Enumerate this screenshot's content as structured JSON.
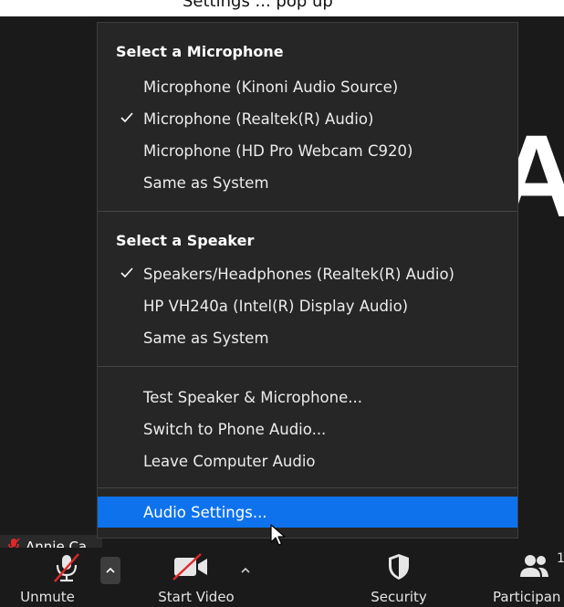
{
  "top_partial_text": "Settings ... pop up",
  "meeting": {
    "big_letter": "A",
    "participant_name": "Annie Ca"
  },
  "audio_menu": {
    "microphone_header": "Select a Microphone",
    "microphones": [
      {
        "label": "Microphone (Kinoni Audio Source)",
        "selected": false
      },
      {
        "label": "Microphone (Realtek(R) Audio)",
        "selected": true
      },
      {
        "label": "Microphone (HD Pro Webcam C920)",
        "selected": false
      },
      {
        "label": "Same as System",
        "selected": false
      }
    ],
    "speaker_header": "Select a Speaker",
    "speakers": [
      {
        "label": "Speakers/Headphones (Realtek(R) Audio)",
        "selected": true
      },
      {
        "label": "HP VH240a (Intel(R) Display Audio)",
        "selected": false
      },
      {
        "label": "Same as System",
        "selected": false
      }
    ],
    "actions": [
      {
        "label": "Test Speaker & Microphone..."
      },
      {
        "label": "Switch to Phone Audio..."
      },
      {
        "label": "Leave Computer Audio"
      }
    ],
    "settings": {
      "label": "Audio Settings...",
      "highlighted": true
    }
  },
  "toolbar": {
    "unmute": "Unmute",
    "start_video": "Start Video",
    "security": "Security",
    "participants": "Participan",
    "participants_count": "1"
  },
  "colors": {
    "background": "#1a1a1a",
    "menu_background": "#262626",
    "highlight": "#0e72ed",
    "muted_red": "#e02828"
  },
  "icons": {
    "mic_muted": "microphone-muted-icon",
    "video_off": "video-off-icon",
    "security": "shield-icon",
    "participants": "participants-icon",
    "check": "checkmark-icon",
    "chevron": "chevron-up-icon",
    "cursor": "mouse-pointer-icon"
  }
}
